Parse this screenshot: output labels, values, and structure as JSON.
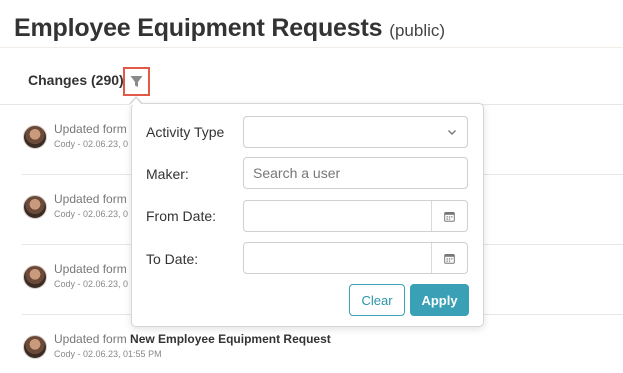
{
  "page": {
    "title": "Employee Equipment Requests",
    "title_suffix": "(public)"
  },
  "changes": {
    "label": "Changes (290)",
    "filter_icon": "funnel-icon"
  },
  "activities": [
    {
      "action": "Updated form",
      "form": "",
      "user_time": "Cody - 02.06.23, 0"
    },
    {
      "action": "Updated form",
      "form": "",
      "user_time": "Cody - 02.06.23, 0"
    },
    {
      "action": "Updated form",
      "form": "",
      "user_time": "Cody - 02.06.23, 0"
    },
    {
      "action": "Updated form",
      "form": "New Employee Equipment Request",
      "user_time": "Cody - 02.06.23, 01:55 PM"
    }
  ],
  "filter": {
    "activity_type": {
      "label": "Activity Type",
      "value": ""
    },
    "maker": {
      "label": "Maker:",
      "placeholder": "Search a user"
    },
    "from_date": {
      "label": "From Date:",
      "value": ""
    },
    "to_date": {
      "label": "To Date:",
      "value": ""
    },
    "clear_label": "Clear",
    "apply_label": "Apply"
  },
  "colors": {
    "accent": "#3aa0b5",
    "highlight_border": "#e05a47"
  }
}
